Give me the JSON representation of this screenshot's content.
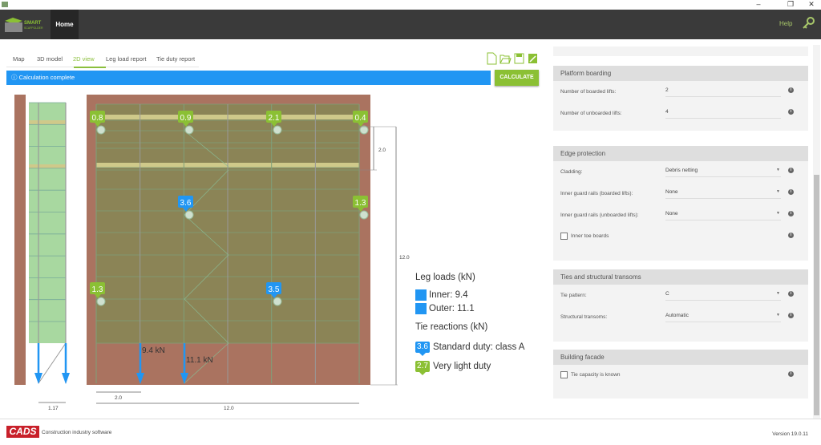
{
  "window": {
    "minimize": "–",
    "maximize": "❐",
    "close": "✕"
  },
  "appbar": {
    "logo_text": "SMART SCAFFOLDER",
    "home": "Home",
    "help": "Help",
    "key_icon": "key-icon"
  },
  "tabs": [
    {
      "label": "Map"
    },
    {
      "label": "3D model"
    },
    {
      "label": "2D view",
      "active": true
    },
    {
      "label": "Leg load report"
    },
    {
      "label": "Tie duty report"
    }
  ],
  "toolbar": {
    "icons": [
      "new-file-icon",
      "open-folder-icon",
      "save-icon",
      "save-as-icon"
    ]
  },
  "status": {
    "icon": "info-icon",
    "text": "Calculation complete"
  },
  "calculate_label": "CALCULATE",
  "drawing": {
    "ties": [
      {
        "value": "0.8",
        "duty": "light"
      },
      {
        "value": "0.9",
        "duty": "light"
      },
      {
        "value": "2.1",
        "duty": "light"
      },
      {
        "value": "0.4",
        "duty": "light"
      },
      {
        "value": "3.6",
        "duty": "standard"
      },
      {
        "value": "1.3",
        "duty": "light"
      },
      {
        "value": "1.3",
        "duty": "light"
      },
      {
        "value": "3.5",
        "duty": "standard"
      }
    ],
    "dims": {
      "lift_height": "2.0",
      "height": "12.0",
      "bay_width": "2.0",
      "length": "12.0",
      "width": "1.17"
    },
    "loads": {
      "inner": "9.4 kN",
      "outer": "11.1 kN"
    }
  },
  "legend": {
    "leg_title": "Leg loads (kN)",
    "inner": "Inner: 9.4",
    "outer": "Outer: 11.1",
    "tie_title": "Tie reactions (kN)",
    "standard_value": "3.6",
    "standard_label": "Standard duty: class A",
    "light_value": "2.7",
    "light_label": "Very light duty"
  },
  "colors": {
    "accent": "#8bc034",
    "blue": "#2196f3",
    "brick": "#aa7360",
    "scaffold": "#8b8456",
    "board": "#cfc98a"
  },
  "panel": {
    "platform": {
      "title": "Platform boarding",
      "boarded_label": "Number of boarded lifts:",
      "boarded": "2",
      "unboarded_label": "Number of unboarded lifts:",
      "unboarded": "4"
    },
    "edge": {
      "title": "Edge protection",
      "cladding_label": "Cladding:",
      "cladding": "Debris netting",
      "igr_b_label": "Inner guard rails (boarded lifts):",
      "igr_b": "None",
      "igr_u_label": "Inner guard rails (unboarded lifts):",
      "igr_u": "None",
      "toe_label": "Inner toe boards"
    },
    "ties": {
      "title": "Ties and structural transoms",
      "pattern_label": "Tie pattern:",
      "pattern": "C",
      "transoms_label": "Structural transoms:",
      "transoms": "Automatic"
    },
    "facade": {
      "title": "Building facade",
      "capacity_label": "Tie capacity is known"
    }
  },
  "footer": {
    "logo": "CADS",
    "tagline": "Construction industry software",
    "version": "Version 19.0.11"
  }
}
